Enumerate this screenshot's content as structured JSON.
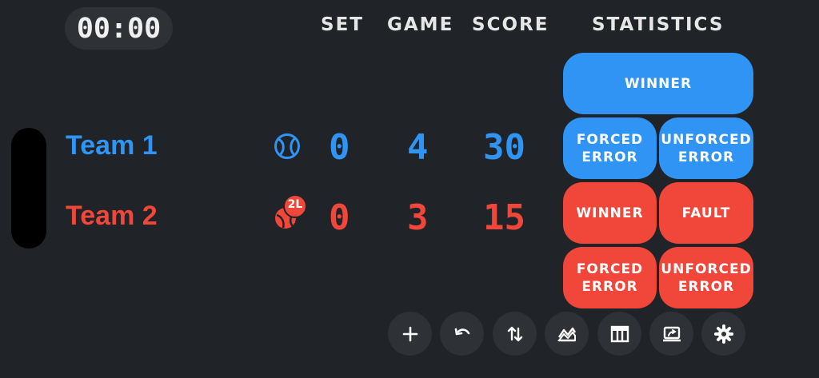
{
  "timer": "00:00",
  "headers": {
    "set": "SET",
    "game": "GAME",
    "score": "SCORE",
    "statistics": "STATISTICS"
  },
  "teams": [
    {
      "name": "Team 1",
      "set": "0",
      "game": "4",
      "score": "30",
      "icon": "tennis-ball-icon",
      "color": "#2f94f3"
    },
    {
      "name": "Team 2",
      "set": "0",
      "game": "3",
      "score": "15",
      "icon": "serve-ball-icon",
      "serve_badge": "2L",
      "color": "#f0473a"
    }
  ],
  "stats": {
    "team1": {
      "winner": "WINNER",
      "forced_error": "FORCED\nERROR",
      "unforced_error": "UNFORCED\nERROR"
    },
    "team2": {
      "winner": "WINNER",
      "fault": "FAULT",
      "forced_error": "FORCED\nERROR",
      "unforced_error": "UNFORCED\nERROR"
    }
  },
  "toolbar": [
    "plus-icon",
    "undo-icon",
    "swap-icon",
    "chart-icon",
    "table-icon",
    "screen-share-icon",
    "gear-icon"
  ]
}
